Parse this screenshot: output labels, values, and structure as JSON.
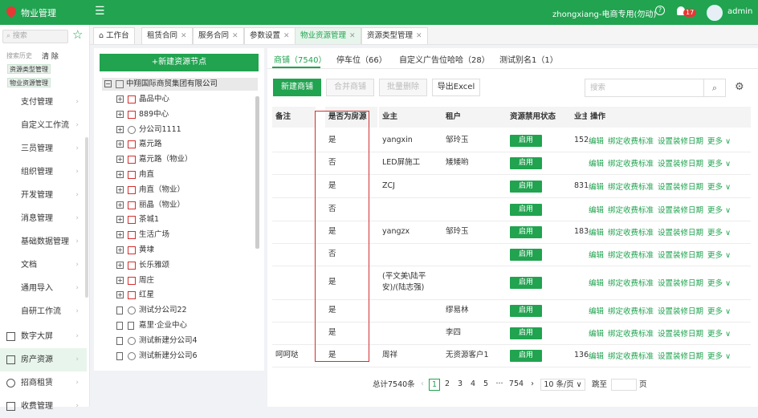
{
  "header": {
    "app_title": "物业管理",
    "tenant": "zhongxiang-电商专用(勿动)",
    "notif_count": "17",
    "user": "admin"
  },
  "sidebar": {
    "search_placeholder": "搜索",
    "history_label": "搜索历史",
    "clear": "清 除",
    "history": [
      "资源类型管理",
      "物业资源管理"
    ],
    "items": [
      {
        "label": "支付管理"
      },
      {
        "label": "自定义工作流"
      },
      {
        "label": "三员管理"
      },
      {
        "label": "组织管理"
      },
      {
        "label": "开发管理"
      },
      {
        "label": "消息管理"
      },
      {
        "label": "基础数据管理"
      },
      {
        "label": "文档"
      },
      {
        "label": "通用导入"
      },
      {
        "label": "自研工作流"
      },
      {
        "label": "数字大屏"
      },
      {
        "label": "房产资源"
      },
      {
        "label": "招商租赁"
      },
      {
        "label": "收费管理"
      }
    ]
  },
  "tabs": [
    {
      "label": "工作台"
    },
    {
      "label": "租赁合同"
    },
    {
      "label": "服务合同"
    },
    {
      "label": "参数设置"
    },
    {
      "label": "物业资源管理"
    },
    {
      "label": "资源类型管理"
    }
  ],
  "tree": {
    "add_button": "+新建资源节点",
    "root": "中翔国际商贸集团有限公司",
    "nodes": [
      {
        "label": "晶品中心"
      },
      {
        "label": "889中心"
      },
      {
        "label": "分公司1111"
      },
      {
        "label": "嘉元路"
      },
      {
        "label": "嘉元路（物业）"
      },
      {
        "label": "甪直"
      },
      {
        "label": "甪直（物业）"
      },
      {
        "label": "丽晶（物业）"
      },
      {
        "label": "茶城1"
      },
      {
        "label": "生活广场"
      },
      {
        "label": "黄埭"
      },
      {
        "label": "长乐雅颂"
      },
      {
        "label": "周庄"
      },
      {
        "label": "红星"
      },
      {
        "label": "测试分公司22"
      },
      {
        "label": "嘉里·企业中心"
      },
      {
        "label": "测试新建分公司4"
      },
      {
        "label": "测试新建分公司6"
      }
    ]
  },
  "subtabs": [
    {
      "label": "商铺（7540）"
    },
    {
      "label": "停车位（66）"
    },
    {
      "label": "自定义广告位哈哈（28）"
    },
    {
      "label": "测试别名1（1）"
    }
  ],
  "toolbar": {
    "new": "新建商铺",
    "merge": "合并商铺",
    "batch_delete": "批量删除",
    "export": "导出Excel",
    "search_placeholder": "搜索"
  },
  "table": {
    "headers": [
      "备注",
      "是否为房源",
      "业主",
      "租户",
      "资源禁用状态",
      "业主",
      "操作"
    ],
    "rows": [
      {
        "note": "",
        "is_house": "是",
        "owner": "yangxin",
        "tenant": "邹玲玉",
        "status": "启用",
        "num": "152"
      },
      {
        "note": "",
        "is_house": "否",
        "owner": "LED屏施工",
        "tenant": "矮矮哟",
        "status": "启用",
        "num": ""
      },
      {
        "note": "",
        "is_house": "是",
        "owner": "ZCJ",
        "tenant": "",
        "status": "启用",
        "num": "831"
      },
      {
        "note": "",
        "is_house": "否",
        "owner": "",
        "tenant": "",
        "status": "启用",
        "num": ""
      },
      {
        "note": "",
        "is_house": "是",
        "owner": "yangzx",
        "tenant": "邹玲玉",
        "status": "启用",
        "num": "183"
      },
      {
        "note": "",
        "is_house": "否",
        "owner": "",
        "tenant": "",
        "status": "启用",
        "num": ""
      },
      {
        "note": "",
        "is_house": "是",
        "owner": "(平文美\\陆平安)/(陆志强)",
        "tenant": "",
        "status": "启用",
        "num": ""
      },
      {
        "note": "",
        "is_house": "是",
        "owner": "",
        "tenant": "缪易林",
        "status": "启用",
        "num": ""
      },
      {
        "note": "",
        "is_house": "是",
        "owner": "",
        "tenant": "李四",
        "status": "启用",
        "num": ""
      },
      {
        "note": "呵呵哒",
        "is_house": "是",
        "owner": "周祥",
        "tenant": "无资源客户1",
        "status": "启用",
        "num": "136"
      }
    ],
    "ops": [
      "编辑",
      "绑定收费标准",
      "设置装修日期",
      "更多 ∨"
    ]
  },
  "pager": {
    "total": "总计7540条",
    "pages": [
      "1",
      "2",
      "3",
      "4",
      "5"
    ],
    "ellipsis": "···",
    "last": "754",
    "size": "10 条/页",
    "goto": "跳至",
    "page_unit": "页"
  }
}
